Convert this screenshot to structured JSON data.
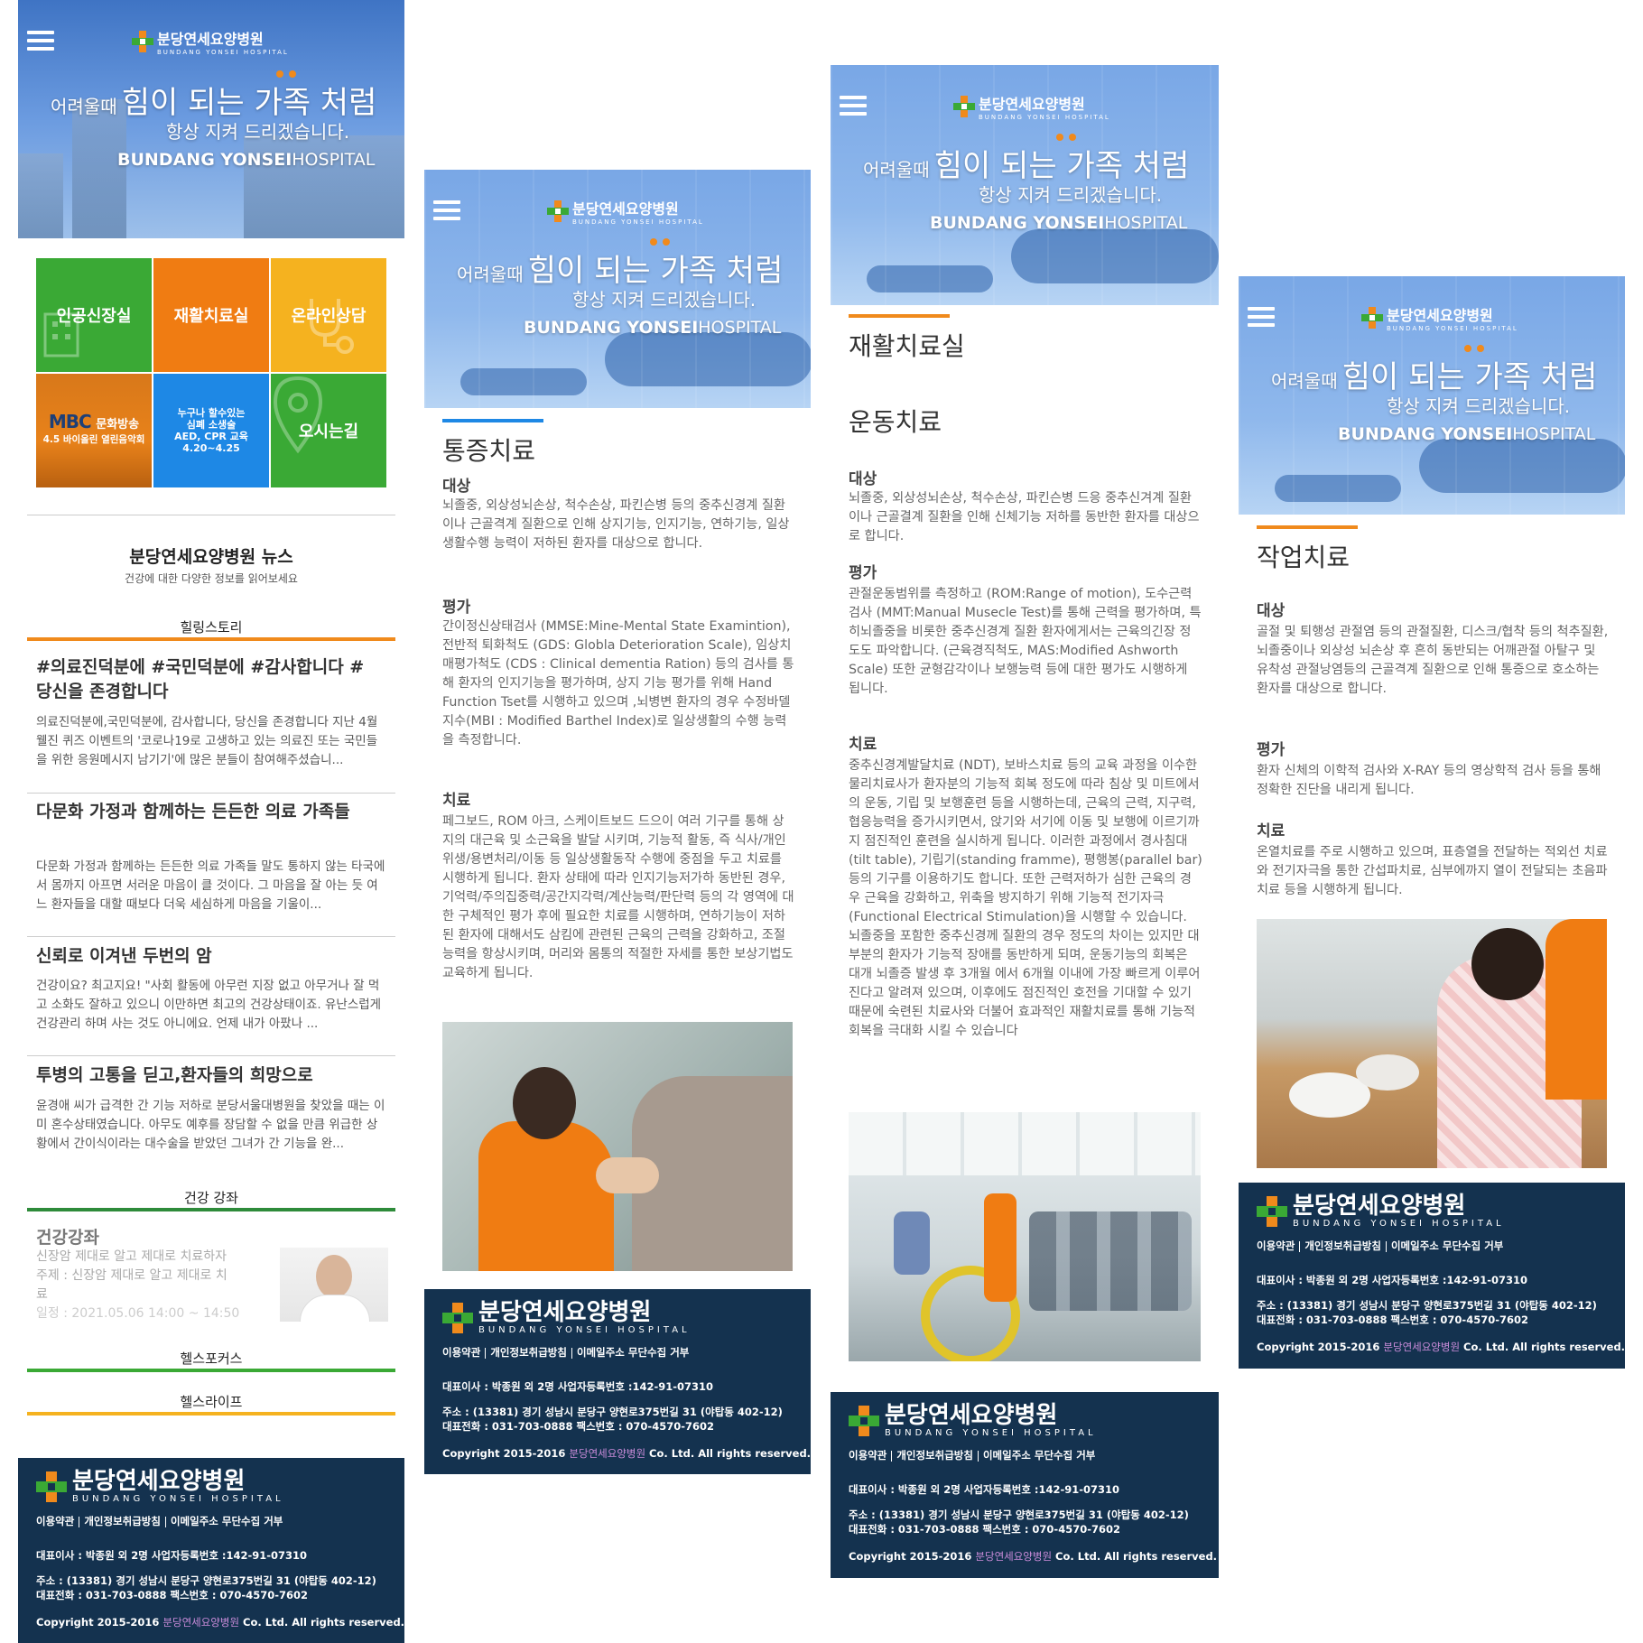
{
  "brand": {
    "name_ko": "분당연세요양병원",
    "name_en": "BUNDANG YONSEI HOSPITAL",
    "colors": {
      "navy": "#14324f",
      "orange": "#f08a1c",
      "green": "#3aa935",
      "yellow": "#f5b21f",
      "blue": "#1e88e5",
      "orange_tile": "#f07c12"
    }
  },
  "hero": {
    "line1_small": "어려울때",
    "line1_big": "힘이 되는 가족 처럼",
    "line2": "항상 지켜 드리겠습니다.",
    "line3_bold": "BUNDANG YONSEI",
    "line3_light": "HOSPITAL",
    "menu_icon": "hamburger-icon"
  },
  "tiles": [
    {
      "label": "인공신장실",
      "color": "#3aa935"
    },
    {
      "label": "재활치료실",
      "color": "#f07c12"
    },
    {
      "label": "온라인상담",
      "color": "#f5b21f"
    },
    {
      "label_mbc": "MBC",
      "label": "문화방송",
      "label2": "4.5 바이올린 열린음악회",
      "color": "#e8821a"
    },
    {
      "label": "누구나 할수있는",
      "label2": "심폐 소생술",
      "label3": "AED, CPR 교육",
      "label4": "4.20~4.25",
      "color": "#1e88e5"
    },
    {
      "label": "오시는길",
      "color": "#3aa935"
    }
  ],
  "news": {
    "title": "분당연세요양병원 뉴스",
    "subtitle": "건강에 대한 다양한 정보를 읽어보세요",
    "cat_healing": "힐링스토리",
    "articles": [
      {
        "title": "#의료진덕분에 #국민덕분에 #감사합니다 #당신을 존경합니다",
        "body": "의료진덕분에,국민덕분에, 감사합니다, 당신을 존경합니다 지난 4월 웰진 퀴즈 이벤트의 '코로나19로 고생하고 있는 의료진 또는 국민들을 위한 응원메시지 남기기'에 많은 분들이 참여해주셨습니..."
      },
      {
        "title": "다문화 가정과 함께하는 든든한 의료 가족들",
        "body": "다문화 가정과 함께하는 든든한 의료 가족들 말도 통하지 않는 타국에서 몸까지 아프면 서러운 마음이 클 것이다. 그 마음을 잘 아는 듯 여느 환자들을 대할 때보다 더욱 세심하게 마음을 기울이..."
      },
      {
        "title": "신뢰로 이겨낸 두번의 암",
        "body": "건강이요? 최고지요! \"사회 활동에 아무런 지장 없고 아무거나 잘 먹고 소화도 잘하고 있으니 이만하면 최고의 건강상태이죠. 유난스럽게 건강관리 하며 사는 것도 아니에요. 언제 내가 아팠나 ..."
      },
      {
        "title": "투병의 고통을 딛고,환자들의 희망으로",
        "body": "윤경애 씨가 급격한 간 기능 저하로 분당서울대병원을 찾았을 때는 이미 혼수상태였습니다. 아무도 예후를 장담할 수 없을 만큼 위급한 상황에서 간이식이라는 대수술을 받았던 그녀가 간 기능을 완..."
      }
    ],
    "cat_lecture": "건강 강좌",
    "lecture": {
      "title": "건강강좌",
      "line1": "신장암 제대로 알고 제대로 치료하자",
      "line2": "주제 : 신장암 제대로 알고 제대로 치",
      "line3": "료",
      "line4": "일정 : 2021.05.06 14:00 ~ 14:50"
    },
    "cat_focus": "헬스포커스",
    "cat_life": "헬스라이프"
  },
  "footer": {
    "links": [
      "이용약관",
      "개인정보취급방침",
      "이메일주소 무단수집 거부"
    ],
    "ceo": "대표이사 : 박종원 외 2명 사업자등록번호 :142-91-07310",
    "address": "주소 : (13381) 경기 성남시 분당구 양현로375번길 31 (야탑동 402-12)",
    "phone": "대표전화 : 031-703-0888  팩스번호 : 070-4570-7602",
    "copy_pre": "Copyright 2015-2016 ",
    "copy_name": "분당연세요양병원",
    "copy_post": " Co. Ltd. All rights reserved."
  },
  "pain": {
    "title": "통증치료",
    "target_h": "대상",
    "target": "뇌졸중, 외상성뇌손상, 척수손상, 파킨슨병 등의 중추신경계 질환이나 근골격계 질환으로 인해 상지기능, 인지기능, 연하기능, 일상생활수행 능력이 저하된 환자를 대상으로 합니다.",
    "eval_h": "평가",
    "eval": "간이정신상태검사 (MMSE:Mine-Mental State Examintion), 전반적 퇴화척도 (GDS: Globla Deterioration Scale), 임상치매평가척도 (CDS : Clinical dementia Ration) 등의 검사를 통해 환자의 인지기능을 평가하며, 상지 기능 평가를 위해 Hand Function Tset를 시행하고 있으며 ,뇌병변 환자의 경우 수정바델지수(MBI : Modified Barthel Index)로 일상생활의 수행 능력을 측정합니다.",
    "treat_h": "치료",
    "treat": "페그보드, ROM 아크, 스케이트보드 드으이 여러 기구를 통해 상지의 대근육 및 소근육을 발달 시키며, 기능적 활동, 즉 식사/개인위생/용변처리/이동 등 일상생활동작 수행에 중점을 두고 치료를 시행하게 됩니다. 환자 상태에 따라 인지기능저가하 동반된 경우, 기억력/주의집중력/공간지각력/계산능력/판단력 등의 각 영역에 대한 구체적인 평가 후에 필요한 치료를 시행하며, 연하기능이 저하된 환자에 대해서도 삼킴에 관련된 근육의 근력을 강화하고, 조절능력을 항상시키며, 머리와 몸통의 적절한 자세를 통한 보상기법도 교육하게 됩니다."
  },
  "rehab": {
    "title": "재활치료실",
    "subtitle": "운동치료",
    "target_h": "대상",
    "target": "뇌졸중, 외상성뇌손상, 척수손상, 파킨슨병 드응 중추신겨계 질환이나 근골결계 질환을 인해 신체기능 저하를 동반한 환자를 대상으로 합니다.",
    "eval_h": "평가",
    "eval": "관절운동범위를 측정하고 (ROM:Range of motion), 도수근력검사 (MMT:Manual Musecle Test)를 통해 근력을 평가하며, 특히뇌졸중을 비롯한 중추신경계 질환 환자에게서는 근육의긴장 정도도 파악합니다. (근육경직척도, MAS:Modified Ashworth Scale) 또한 균형감각이나 보행능력 등에 대한 평가도 시행하게 됩니다.",
    "treat_h": "치료",
    "treat": "중추신경계발달치료 (NDT), 보바스치료 등의 교육 과정을 이수한 물리치료사가 환자분의 기능적 회복 정도에 따라 침상 및 미트에서의 운동, 기립 및 보행훈련 등을 시행하는데, 근육의 근력, 지구력, 협응능력을 증가시키면서, 앉기와 서기에 이동 및 보행에 이르기까지 점진적인 훈련을 실시하게 됩니다. 이러한 과정에서 경사침대 (tilt table), 기립기(standing framme), 평행봉(parallel bar) 등의 기구를 이용하기도 합니다. 또한 근력저하가 심한 근육의 경우 근육을 강화하고, 위축을 방지하기 위해 기능적 전기자극 (Functional Electrical Stimulation)을 시행할 수 있습니다. 뇌졸중을 포함한 중추신경께 질환의 경우 정도의 차이는 있지만 대부분의 환자가 기능적 장애를 동반하게 되며, 운동기능의 회복은 대개 뇌졸증 발생 후 3개월 에서 6개월 이내에 가장 빠르게 이루어진다고 알려져 있으며, 이후에도 점진적인 호전을 기대할 수 있기 때문에 숙련된 치료사와 더불어 효과적인 재활치료를 통해 기능적 회복을 극대화 시킬 수 있습니다"
  },
  "occ": {
    "title": "작업치료",
    "target_h": "대상",
    "target": "골절 및 퇴행성 관절염 등의 관절질환, 디스크/협착 등의 척추질환, 뇌졸중이나 외상성 뇌손상 후 흔히 동반되는 어깨관절 아탈구 및 유착성 관절낭염등의 근골격계 질환으로 인해 통증으로 호소하는 환자를 대상으로 합니다.",
    "eval_h": "평가",
    "eval": "환자 신체의 이학적 검사와 X-RAY 등의 영상학적 검사 등을 통해 정확한 진단을 내리게 됩니다.",
    "treat_h": "치료",
    "treat": "온열치료를 주로 시행하고 있으며, 표층열을 전달하는 적외선 치료와 전기자극을 통한 간섭파치료, 심부에까지 열이 전달되는 초음파치료 등을 시행하게 됩니다."
  }
}
